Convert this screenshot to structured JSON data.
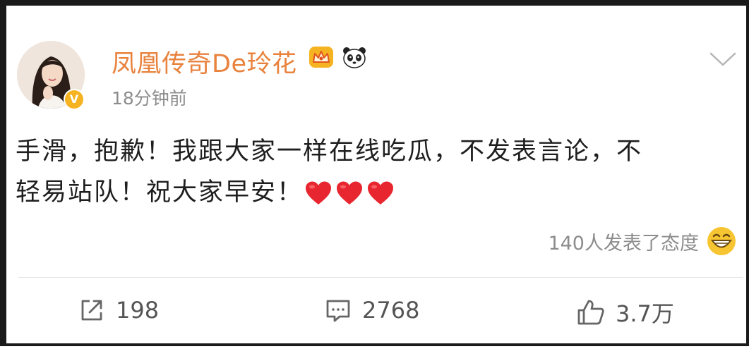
{
  "post": {
    "username": "凤凰传奇De玲花",
    "timestamp": "18分钟前",
    "verified_mark": "V",
    "badges": [
      "crown-icon",
      "panda-icon"
    ],
    "content_line1": "手滑，抱歉！我跟大家一样在线吃瓜，不发表言论，不",
    "content_line2": "轻易站队！祝大家早安！",
    "content_emojis": [
      "heart-icon",
      "heart-icon",
      "heart-icon"
    ],
    "attitude_text": "140人发表了态度",
    "attitude_emoji": "grin-emoji-icon"
  },
  "actions": {
    "repost_count": "198",
    "comment_count": "2768",
    "like_count": "3.7万"
  },
  "colors": {
    "username": "#e8823d",
    "muted_text": "#8c8c8c",
    "body_text": "#1e1e1e",
    "verified": "#f6b321",
    "heart": "#e8262f"
  }
}
